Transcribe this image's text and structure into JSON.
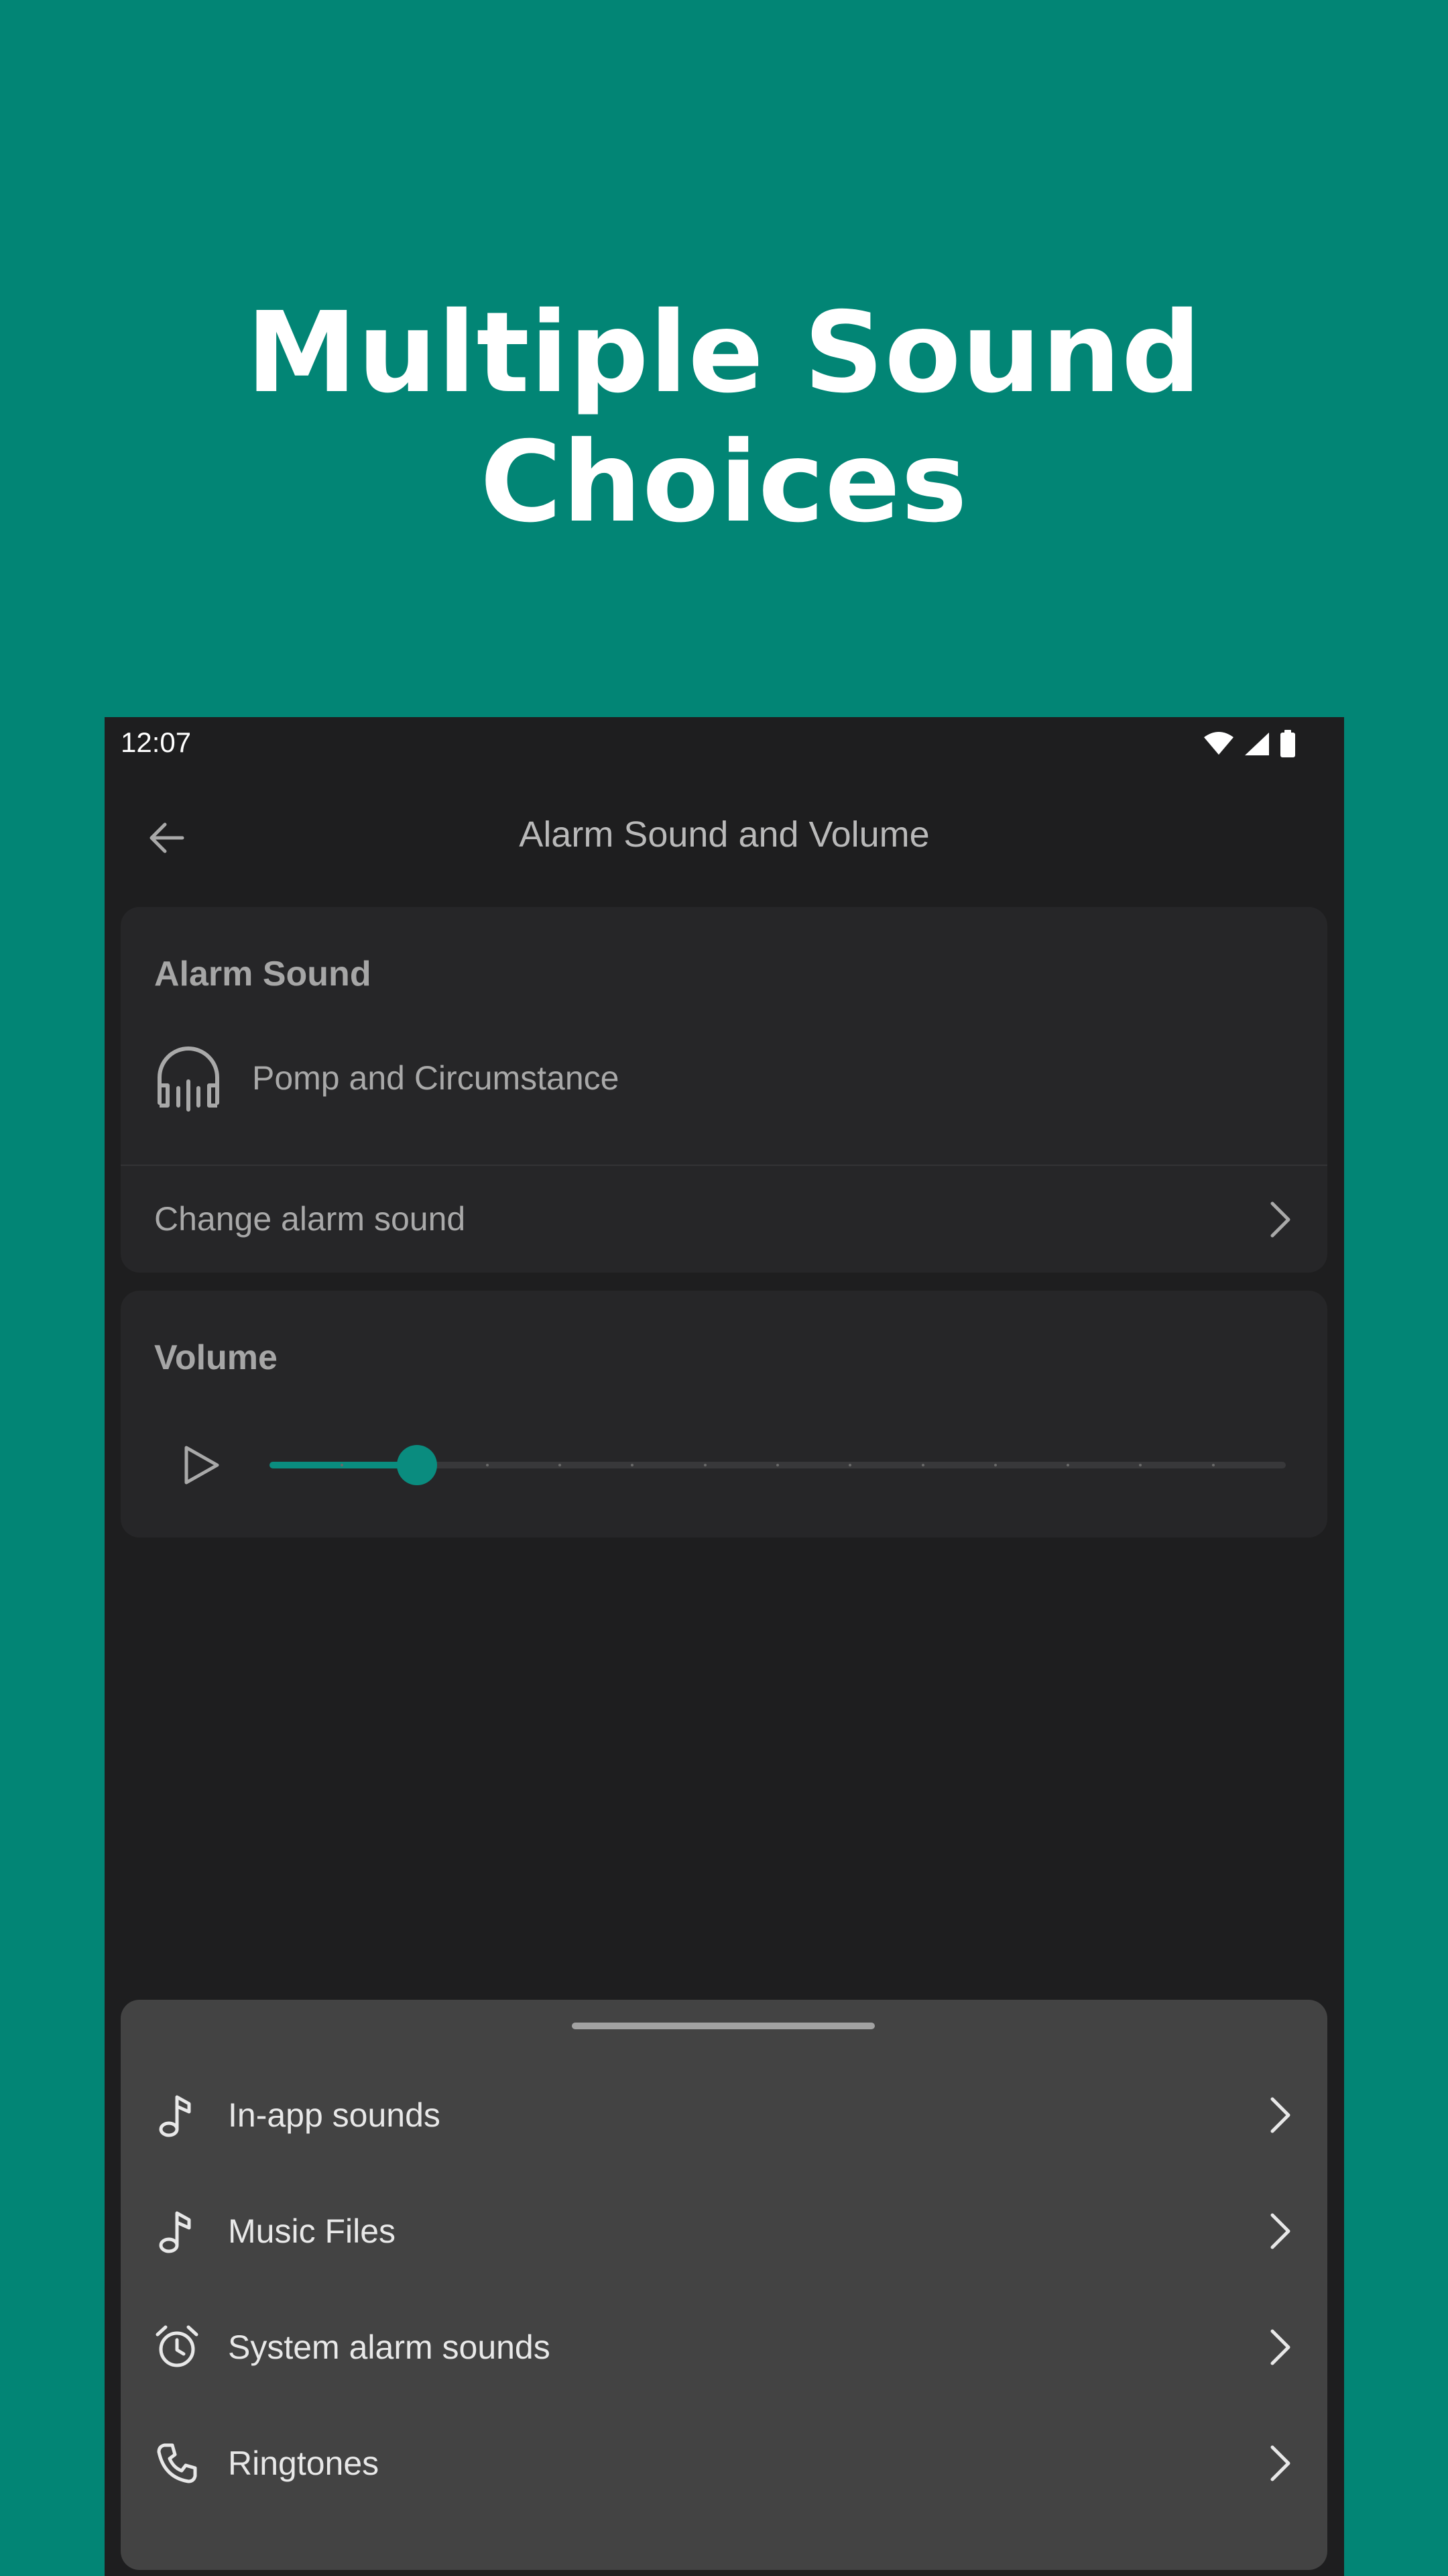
{
  "headline": "Multiple Sound Choices",
  "status_bar": {
    "time": "12:07"
  },
  "topbar": {
    "title": "Alarm Sound and Volume"
  },
  "alarm_sound": {
    "label": "Alarm Sound",
    "current_sound": "Pomp and Circumstance",
    "change_label": "Change alarm sound"
  },
  "volume": {
    "label": "Volume",
    "level": 0.145,
    "steps": 14
  },
  "sheet": {
    "items": [
      {
        "label": "In-app sounds",
        "icon": "music-note-icon"
      },
      {
        "label": "Music Files",
        "icon": "music-note-icon"
      },
      {
        "label": "System alarm sounds",
        "icon": "alarm-clock-icon"
      },
      {
        "label": "Ringtones",
        "icon": "phone-icon"
      }
    ]
  },
  "colors": {
    "background": "#028575",
    "screen": "#1e1e1f",
    "card": "#262628",
    "sheet": "#434343",
    "accent": "#0a8c7f"
  }
}
